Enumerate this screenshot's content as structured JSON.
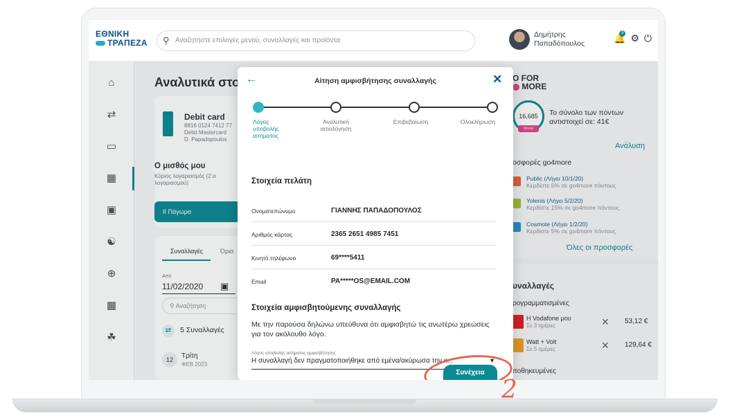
{
  "app": {
    "logo_line1": "ΕΘΝΙΚΗ",
    "logo_line2": "ΤΡΑΠΕΖΑ",
    "search_placeholder": "Αναζητήστε επιλογές μενού, συναλλαγές και προϊόντα",
    "user_first": "Δημήτρης",
    "user_last": "Παπαδόπουλος",
    "notification_count": "3"
  },
  "background": {
    "page_title": "Αναλυτικά στοιχ",
    "card_title": "Debit card",
    "card_number": "8816 0124 7412 77",
    "card_type": "Debit Mastercard",
    "card_holder": "D. Papadopoulos",
    "account_title": "Ο μισθός μου",
    "account_sub": "Κύριος λογαριασμός (2 α λογαριασμού)",
    "freeze_label": "II  Πάγωμα",
    "tab_transactions": "Συναλλαγές",
    "tab_limits": "Όρια",
    "from_label": "Από",
    "from_value": "11/02/2020",
    "search_label": "Αναζήτηση",
    "tx_count": "5 Συναλλαγές",
    "tx_day_num": "12",
    "tx_day_name": "Τρίτη",
    "tx_month": "ΦΕΒ 2023"
  },
  "rewards": {
    "brand_line1": "O FOR",
    "brand_line2": "MORE",
    "points": "16,685",
    "points_tag": "πόντοι",
    "points_text": "Το σύνολο των πόντων αντιστοιχεί σε: 41€",
    "analysis_link": "Ανάλυση",
    "offers_title": "οσφορές go4more",
    "offers": [
      {
        "name": "Public  (Λήγει 10/1/20)",
        "desc": "Κερδίστε 5% σε go4more πόντους",
        "color": "#e8623a"
      },
      {
        "name": "Yolenis  (Λήγει 5/2/20)",
        "desc": "Κερδίστε 15% σε go4more πόντους",
        "color": "#9cc43a"
      },
      {
        "name": "Cosmote  (Λήγει 1/2/20)",
        "desc": "Κερδίστε 5% σε go4more πόντους",
        "color": "#2a8fd0"
      }
    ],
    "all_offers_link": "Όλες οι προσφορές"
  },
  "recurring": {
    "title": "υναλλαγές",
    "planned_label": "ρογραμματισμένες",
    "bills": [
      {
        "name": "H Vodafone μου",
        "sub": "Σε 3 ημέρες",
        "amount": "53,12 €",
        "color": "#e01f26"
      },
      {
        "name": "Watt + Volt",
        "sub": "Σε 5 ημέρες",
        "amount": "129,64 €",
        "color": "#f0a12a"
      }
    ],
    "saved_label": "ποθηκευμένες"
  },
  "modal": {
    "title": "Αίτηση αμφισβήτησης συναλλαγής",
    "steps": [
      {
        "label": "Λόγος υποβολής αιτήματος",
        "active": true
      },
      {
        "label": "Αναλυτική αιτιολόγηση",
        "active": false
      },
      {
        "label": "Επιβεβαίωση",
        "active": false
      },
      {
        "label": "Ολοκλήρωση",
        "active": false
      }
    ],
    "customer_section_title": "Στοιχεία πελάτη",
    "customer_rows": [
      {
        "key": "Ονοματεπώνυμο",
        "value": "ΓΙΑΝΝΗΣ ΠΑΠΑΔΟΠΟΥΛΟΣ"
      },
      {
        "key": "Αριθμός κάρτας",
        "value": "2365 2651 4985 7451"
      },
      {
        "key": "Κινητό τηλέφωνο",
        "value": "69****5411"
      },
      {
        "key": "Email",
        "value": "PA*****OS@EMAIL.COM"
      }
    ],
    "dispute_section_title": "Στοιχεία αμφισβητούμενης συναλλαγής",
    "declaration": "Με την παρούσα δηλώνω υπεύθυνα ότι αμφισβητώ τις ανωτέρω χρεώσεις για τον ακόλουθο λόγο.",
    "reason_label": "Λόγος υποβολής αιτήματος αμφισβήτησης",
    "reason_value": "Η συναλλαγή δεν πραγματοποιήθηκε από εμένα/ακύρωσα την κ...",
    "continue_label": "Συνέχεια"
  },
  "annotation": {
    "step_number": "2"
  },
  "colors": {
    "accent": "#0b8a94",
    "step_active": "#33b5c4",
    "highlight": "#e2674e"
  }
}
